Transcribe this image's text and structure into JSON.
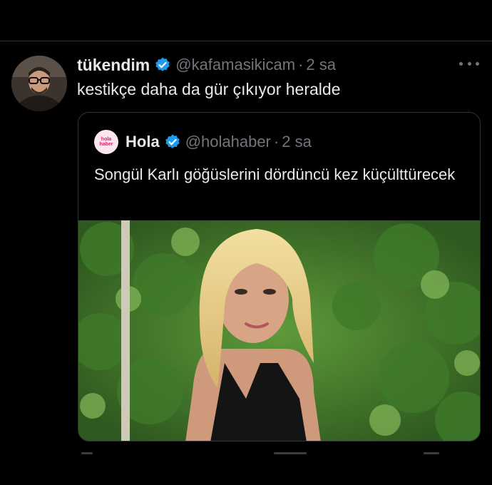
{
  "tweet": {
    "display_name": "tükendim",
    "handle": "@kafamasikicam",
    "separator": "·",
    "time": "2 sa",
    "text": "kestikçe daha da gür çıkıyor heralde"
  },
  "quoted_tweet": {
    "avatar_text_top": "hola",
    "avatar_text_bottom": "haber",
    "display_name": "Hola",
    "handle": "@holahaber",
    "separator": "·",
    "time": "2 sa",
    "text": "Songül Karlı göğüslerini dördüncü kez küçülttürecek"
  },
  "icons": {
    "verified": "verified-badge-icon",
    "more": "more-options-icon"
  },
  "colors": {
    "background": "#000000",
    "text": "#e7e9ea",
    "muted": "#71767b",
    "verified": "#1d9bf0",
    "border": "#2f3336"
  }
}
